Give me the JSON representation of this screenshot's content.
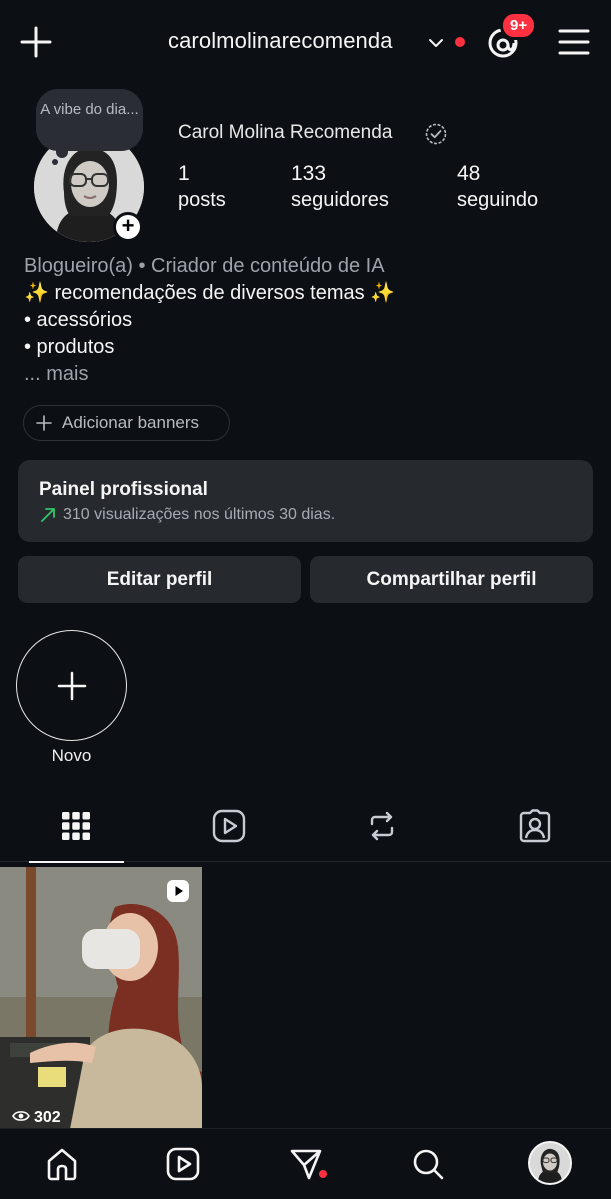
{
  "header": {
    "username": "carolmolinarecomenda",
    "notification_badge": "9+",
    "icons": [
      "plus-icon",
      "chevron-down-icon",
      "threads-icon",
      "hamburger-menu-icon"
    ]
  },
  "note": {
    "text": "A vibe do dia..."
  },
  "profile": {
    "display_name": "Carol Molina Recomenda",
    "stats": {
      "posts": {
        "value": "1",
        "label": "posts"
      },
      "followers": {
        "value": "133",
        "label": "seguidores"
      },
      "following": {
        "value": "48",
        "label": "seguindo"
      }
    }
  },
  "bio": {
    "category": "Blogueiro(a) • Criador de conteúdo de IA",
    "line1": "✨ recomendações de diversos temas ✨",
    "line2": "• acessórios",
    "line3": "• produtos",
    "more": "... mais"
  },
  "banners": {
    "label": "Adicionar banners"
  },
  "professional_panel": {
    "title": "Painel profissional",
    "subtitle": "310 visualizações nos últimos 30 dias."
  },
  "actions": {
    "edit_label": "Editar perfil",
    "share_label": "Compartilhar perfil"
  },
  "highlights": {
    "new_label": "Novo"
  },
  "tabs": [
    "grid-icon",
    "reels-icon",
    "reposts-icon",
    "tagged-icon"
  ],
  "posts": [
    {
      "views": "302",
      "type": "reel"
    }
  ],
  "bottom_nav": [
    "home-icon",
    "reels-icon",
    "direct-icon",
    "search-icon",
    "profile-avatar"
  ],
  "colors": {
    "background": "#0c0f14",
    "card": "#26292e",
    "accent_red": "#ff3040",
    "trend_green": "#2fc86b"
  }
}
